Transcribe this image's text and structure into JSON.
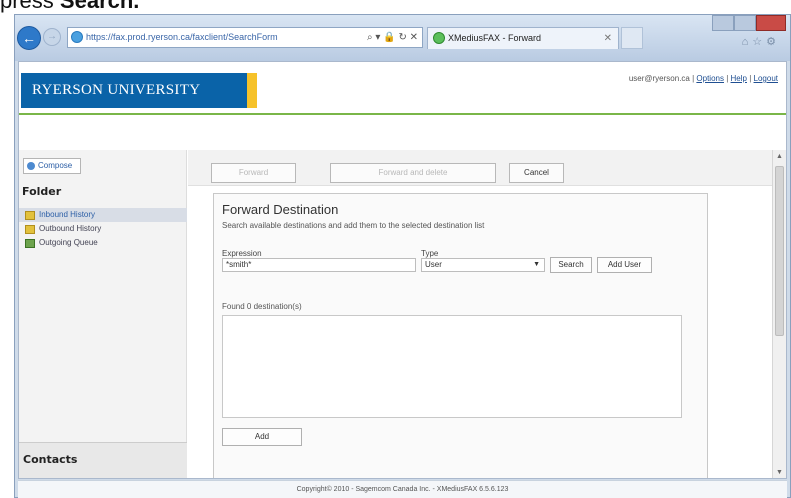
{
  "caption": {
    "prefix": "press ",
    "bold": "Search."
  },
  "browser": {
    "url": "https://fax.prod.ryerson.ca/faxclient/SearchForm",
    "tab_title": "XMediusFAX - Forward"
  },
  "header": {
    "logo_text": "RYERSON UNIVERSITY",
    "user_email": "user@ryerson.ca",
    "separator": "|",
    "links": [
      "Options",
      "Help",
      "Logout"
    ]
  },
  "sidebar": {
    "compose_label": "Compose",
    "folder_title": "Folder",
    "items": [
      {
        "label": "Inbound History",
        "selected": true
      },
      {
        "label": "Outbound History",
        "selected": false
      },
      {
        "label": "Outgoing Queue",
        "selected": false
      }
    ],
    "contacts_title": "Contacts"
  },
  "toolbar": {
    "forward_label": "Forward",
    "forward_delete_label": "Forward and delete",
    "cancel_label": "Cancel"
  },
  "forward": {
    "legend": "Forward Destination",
    "description": "Search available destinations and add them to the selected destination list",
    "expression_label": "Expression",
    "expression_value": "*smith*",
    "type_label": "Type",
    "type_value": "User",
    "search_label": "Search",
    "add_user_label": "Add User",
    "found_text": "Found 0 destination(s)",
    "add_label": "Add"
  },
  "footer": {
    "text": "Copyright© 2010 - Sagemcom Canada Inc. - XMediusFAX 6.5.6.123"
  }
}
